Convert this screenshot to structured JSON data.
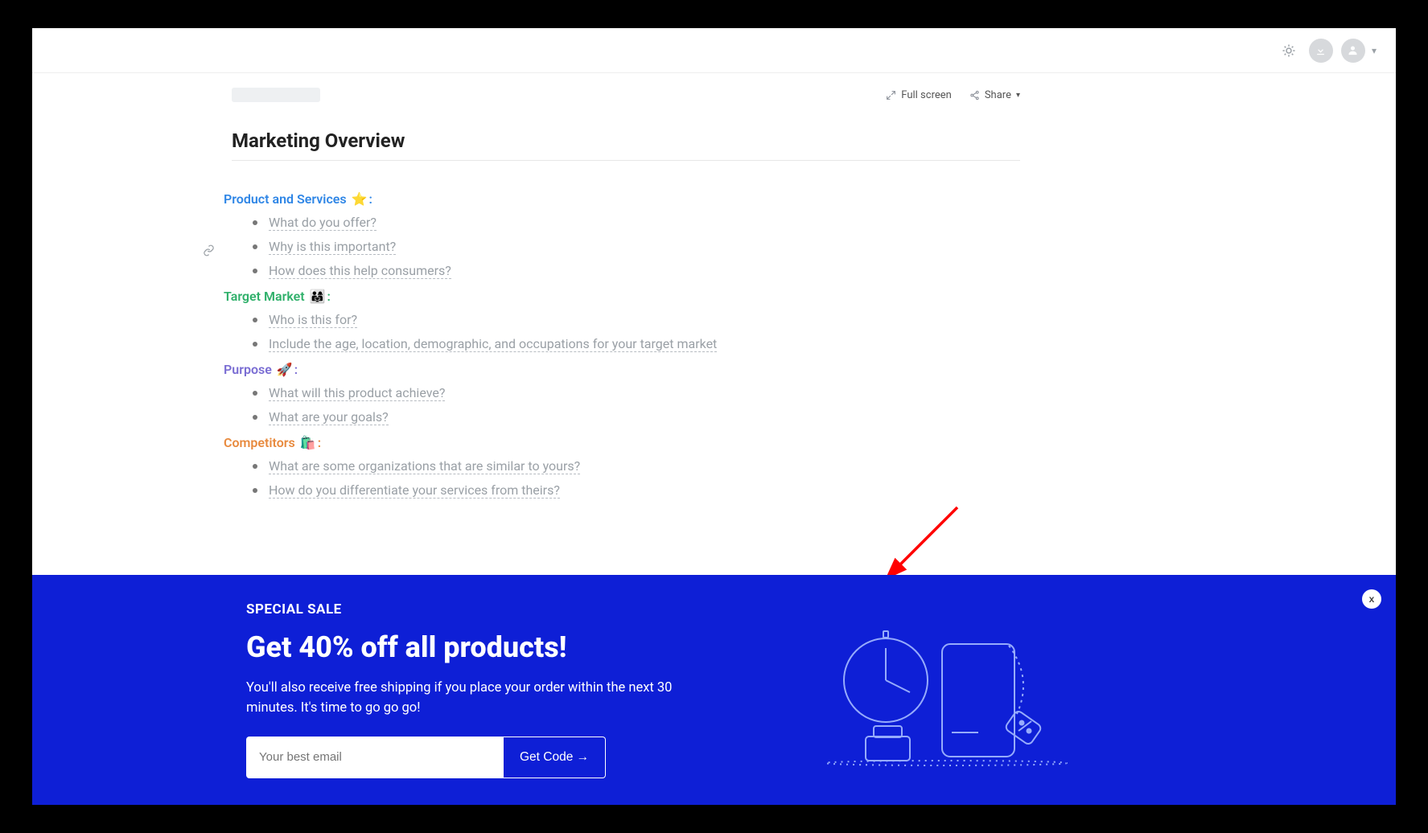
{
  "topbar": {
    "brightness_icon": "brightness",
    "download_icon": "download",
    "user_icon": "user"
  },
  "doc": {
    "actions": {
      "fullscreen": "Full screen",
      "share": "Share"
    },
    "title": "Marketing Overview",
    "sections": [
      {
        "heading": "Product and Services",
        "emoji": "⭐",
        "color": "c-blue",
        "items": [
          "What do you offer?",
          "Why is this important?",
          "How does this help consumers?"
        ]
      },
      {
        "heading": "Target Market",
        "emoji": "👨‍👩‍👧",
        "color": "c-green",
        "items": [
          "Who is this for?",
          "Include the age, location, demographic, and occupations for your target market"
        ]
      },
      {
        "heading": "Purpose",
        "emoji": "🚀",
        "color": "c-purple",
        "items": [
          "What will this product achieve?",
          "What are your goals?"
        ]
      },
      {
        "heading": "Competitors",
        "emoji": "🛍️",
        "color": "c-orange",
        "items": [
          "What are some organizations that are similar to yours?",
          "How do you differentiate your services from theirs?"
        ]
      }
    ]
  },
  "banner": {
    "eyebrow": "SPECIAL SALE",
    "headline": "Get 40% off all products!",
    "body": "You'll also receive free shipping if you place your order within the next 30 minutes. It's time to go go go!",
    "email_placeholder": "Your best email",
    "cta": "Get Code →",
    "close": "x"
  }
}
